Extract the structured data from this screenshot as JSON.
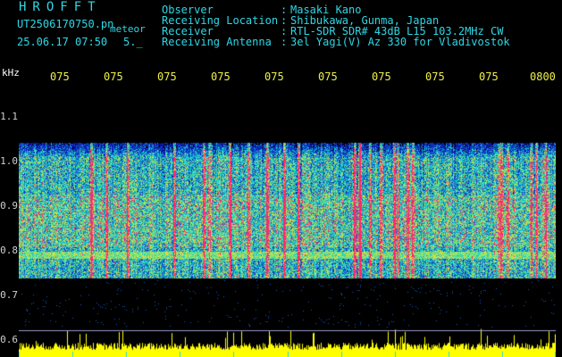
{
  "app": {
    "logo": "HROFFT"
  },
  "file": {
    "name": "UT2506170750.pn",
    "suffix": "meteor",
    "datetime": "25.06.17 07:50",
    "extra": "5._"
  },
  "header": {
    "rows": [
      {
        "label": "Observer",
        "value": "Masaki Kano"
      },
      {
        "label": "Receiving Location",
        "value": "Shibukawa, Gunma, Japan"
      },
      {
        "label": "Receiver",
        "value": "RTL-SDR SDR# 43dB L15 103.2MHz CW"
      },
      {
        "label": "Receiving Antenna",
        "value": "3el Yagi(V) Az 330 for Vladivostok"
      }
    ]
  },
  "axis": {
    "unit": "kHz",
    "y_labels": [
      "1.1",
      "1.0",
      "0.9",
      "0.8",
      "0.7",
      "0.6"
    ],
    "time_labels": [
      "075",
      "075",
      "075",
      "075",
      "075",
      "075",
      "075",
      "075",
      "075",
      "0800"
    ]
  },
  "colors": {
    "background": "#000000",
    "text_cyan": "#2fd7e6",
    "time_label": "#f0f04a",
    "echo_bar": "#ffff00",
    "noise_low": "#0a1aa0",
    "noise_mid": "#14e0c8",
    "noise_high": "#ff2a6a"
  }
}
